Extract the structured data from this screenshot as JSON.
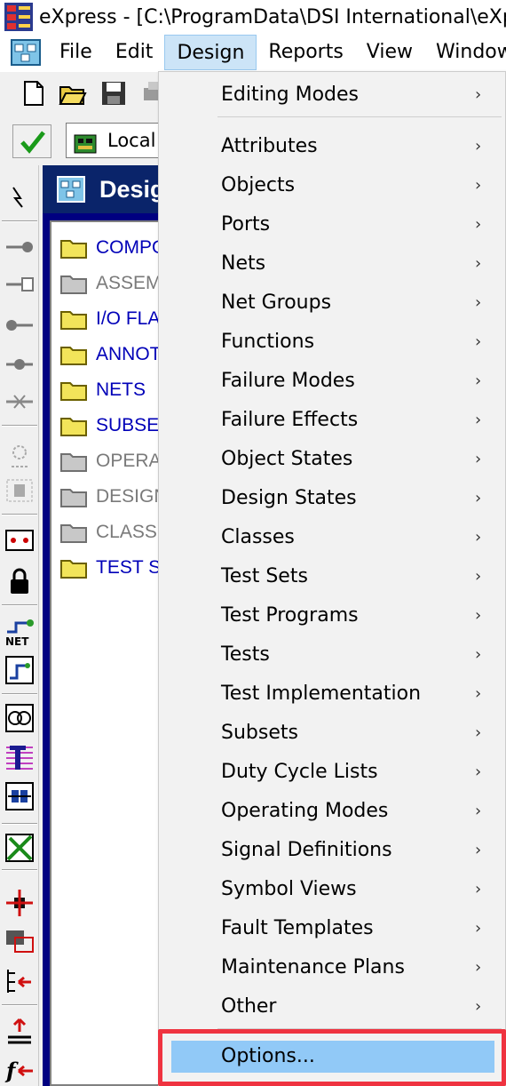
{
  "window": {
    "title": "eXpress - [C:\\ProgramData\\DSI International\\eXpre"
  },
  "menubar": {
    "items": [
      {
        "label": "File",
        "active": false
      },
      {
        "label": "Edit",
        "active": false
      },
      {
        "label": "Design",
        "active": true
      },
      {
        "label": "Reports",
        "active": false
      },
      {
        "label": "View",
        "active": false
      },
      {
        "label": "Window",
        "active": false
      }
    ]
  },
  "toolbar": {
    "combo_value": "Local"
  },
  "design_window": {
    "title": "Design"
  },
  "tree": {
    "items": [
      {
        "label": "COMPONENTS",
        "enabled": true
      },
      {
        "label": "ASSEMBLIES",
        "enabled": false
      },
      {
        "label": "I/O FLAGS",
        "enabled": true
      },
      {
        "label": "ANNOTATIONS",
        "enabled": true
      },
      {
        "label": "NETS",
        "enabled": true
      },
      {
        "label": "SUBSETS",
        "enabled": true
      },
      {
        "label": "OPERATING",
        "enabled": false
      },
      {
        "label": "DESIGN",
        "enabled": false
      },
      {
        "label": "CLASSES",
        "enabled": false
      },
      {
        "label": "TEST SETS",
        "enabled": true
      }
    ]
  },
  "design_menu": {
    "items": [
      {
        "label": "Editing Modes",
        "submenu": true
      },
      {
        "label": "Attributes",
        "submenu": true
      },
      {
        "label": "Objects",
        "submenu": true
      },
      {
        "label": "Ports",
        "submenu": true
      },
      {
        "label": "Nets",
        "submenu": true
      },
      {
        "label": "Net Groups",
        "submenu": true
      },
      {
        "label": "Functions",
        "submenu": true
      },
      {
        "label": "Failure Modes",
        "submenu": true
      },
      {
        "label": "Failure Effects",
        "submenu": true
      },
      {
        "label": "Object States",
        "submenu": true
      },
      {
        "label": "Design States",
        "submenu": true
      },
      {
        "label": "Classes",
        "submenu": true
      },
      {
        "label": "Test Sets",
        "submenu": true
      },
      {
        "label": "Test Programs",
        "submenu": true
      },
      {
        "label": "Tests",
        "submenu": true
      },
      {
        "label": "Test Implementation",
        "submenu": true
      },
      {
        "label": "Subsets",
        "submenu": true
      },
      {
        "label": "Duty Cycle Lists",
        "submenu": true
      },
      {
        "label": "Operating Modes",
        "submenu": true
      },
      {
        "label": "Signal Definitions",
        "submenu": true
      },
      {
        "label": "Symbol Views",
        "submenu": true
      },
      {
        "label": "Fault Templates",
        "submenu": true
      },
      {
        "label": "Maintenance Plans",
        "submenu": true
      },
      {
        "label": "Other",
        "submenu": true
      },
      {
        "label": "Options...",
        "submenu": false,
        "highlighted": true
      }
    ],
    "submenu_arrow": "›"
  },
  "colors": {
    "menu_highlight": "#91c9f7",
    "focus_outline": "#ef3340",
    "tree_enabled": "#0000b8",
    "tree_disabled": "#7a7a7a"
  }
}
